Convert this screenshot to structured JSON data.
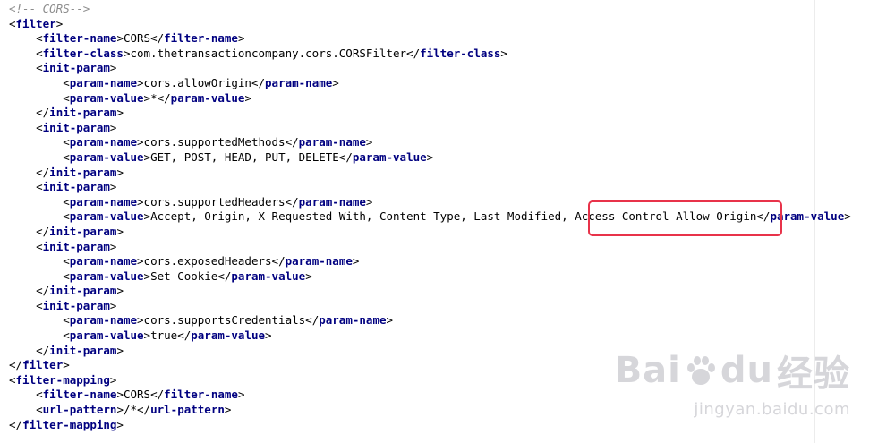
{
  "editor": {
    "lines": [
      {
        "indent": 0,
        "comment": "<!-- CORS-->"
      },
      {
        "indent": 0,
        "open": "filter"
      },
      {
        "indent": 1,
        "open": "filter-name",
        "value": "CORS",
        "close": "filter-name"
      },
      {
        "indent": 1,
        "open": "filter-class",
        "value": "com.thetransactioncompany.cors.CORSFilter",
        "close": "filter-class"
      },
      {
        "indent": 1,
        "open": "init-param"
      },
      {
        "indent": 2,
        "open": "param-name",
        "value": "cors.allowOrigin",
        "close": "param-name"
      },
      {
        "indent": 2,
        "open": "param-value",
        "value": "*",
        "close": "param-value"
      },
      {
        "indent": 1,
        "close": "init-param"
      },
      {
        "indent": 1,
        "open": "init-param"
      },
      {
        "indent": 2,
        "open": "param-name",
        "value": "cors.supportedMethods",
        "close": "param-name"
      },
      {
        "indent": 2,
        "open": "param-value",
        "value": "GET, POST, HEAD, PUT, DELETE",
        "close": "param-value"
      },
      {
        "indent": 1,
        "close": "init-param"
      },
      {
        "indent": 1,
        "open": "init-param"
      },
      {
        "indent": 2,
        "open": "param-name",
        "value": "cors.supportedHeaders",
        "close": "param-name"
      },
      {
        "indent": 2,
        "open": "param-value",
        "value": "Accept, Origin, X-Requested-With, Content-Type, Last-Modified, Access-Control-Allow-Origin",
        "close": "param-value"
      },
      {
        "indent": 1,
        "close": "init-param"
      },
      {
        "indent": 1,
        "open": "init-param"
      },
      {
        "indent": 2,
        "open": "param-name",
        "value": "cors.exposedHeaders",
        "close": "param-name"
      },
      {
        "indent": 2,
        "open": "param-value",
        "value": "Set-Cookie",
        "close": "param-value"
      },
      {
        "indent": 1,
        "close": "init-param"
      },
      {
        "indent": 1,
        "open": "init-param"
      },
      {
        "indent": 2,
        "open": "param-name",
        "value": "cors.supportsCredentials",
        "close": "param-name"
      },
      {
        "indent": 2,
        "open": "param-value",
        "value": "true",
        "close": "param-value"
      },
      {
        "indent": 1,
        "close": "init-param"
      },
      {
        "indent": 0,
        "close": "filter"
      },
      {
        "indent": 0,
        "open": "filter-mapping"
      },
      {
        "indent": 1,
        "open": "filter-name",
        "value": "CORS",
        "close": "filter-name"
      },
      {
        "indent": 1,
        "open": "url-pattern",
        "value": "/*",
        "close": "url-pattern"
      },
      {
        "indent": 0,
        "close": "filter-mapping"
      }
    ]
  },
  "watermark": {
    "brand": "Bai",
    "brand_suffix": "du",
    "brand_cn": "经验",
    "url": "jingyan.baidu.com"
  },
  "colors": {
    "tag": "#000080",
    "comment": "#8c8c8c",
    "highlight_border": "#e8334a"
  }
}
